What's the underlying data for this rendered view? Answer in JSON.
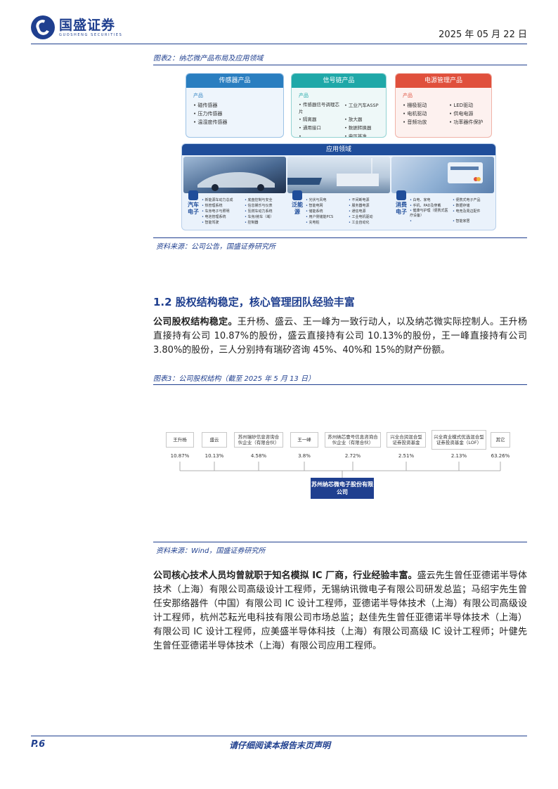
{
  "header": {
    "brand_cn": "国盛证券",
    "brand_en": "GUOSHENG SECURITIES",
    "date": "2025 年 05 月 22 日"
  },
  "figure2": {
    "caption": "图表2：纳芯微产品布局及应用领域",
    "products": [
      {
        "title": "传感器产品",
        "subtitle": "产品",
        "items": [
          "磁传感器",
          "压力传感器",
          "温湿度传感器"
        ]
      },
      {
        "title": "信号链产品",
        "subtitle": "产品",
        "items": [
          "传感器信号调理芯片",
          "工业汽车ASSP",
          "隔离器",
          "放大器",
          "通用接口",
          "数据转换器",
          "电压基准"
        ]
      },
      {
        "title": "电源管理产品",
        "subtitle": "产品",
        "items": [
          "栅极驱动",
          "LED驱动",
          "电机驱动",
          "供电电源",
          "音频功放",
          "功率器件保护"
        ]
      }
    ],
    "app_title": "应用领域",
    "apps": [
      {
        "name": "汽车电子",
        "items": [
          "新能源车动力总成",
          "底盘控制与安全",
          "热管理系统",
          "信息娱乐与仪表",
          "车身电子与照明",
          "氢燃车动力系统",
          "电池管理系统",
          "车身/舱车（域）",
          "智能驾驶",
          "控制器"
        ]
      },
      {
        "name": "泛能源",
        "items": [
          "光伏与风电",
          "不间断电源",
          "智能电网",
          "服务器电源",
          "储能系统",
          "通信电源",
          "用户侧储能PCS",
          "工业电机驱动",
          "充电桩",
          "工业自动化"
        ]
      },
      {
        "name": "消费电子",
        "items": [
          "白电、家电",
          "便携式电子产品",
          "手机、PAD及穿戴",
          "数据存储",
          "健康与护理（便携式医疗设备）",
          "电竞及周边配件",
          "",
          "智能家居"
        ]
      }
    ],
    "source": "资料来源：公司公告，国盛证券研究所"
  },
  "section": {
    "heading": "1.2  股权结构稳定，核心管理团队经验丰富",
    "para1_bold": "公司股权结构稳定。",
    "para1": "王升杨、盛云、王一峰为一致行动人，以及纳芯微实际控制人。王升杨直接持有公司 10.87%的股份，盛云直接持有公司 10.13%的股份，王一峰直接持有公司 3.80%的股份，三人分别持有瑞矽咨询 45%、40%和 15%的财产份额。"
  },
  "figure3": {
    "caption": "图表3：公司股权结构（截至 2025 年 5 月 13 日）",
    "shareholders": [
      {
        "name": "王升杨",
        "pct": "10.87%"
      },
      {
        "name": "盛云",
        "pct": "10.13%"
      },
      {
        "name": "苏州瑞矽信息咨询合伙企业（有限合伙）",
        "pct": "4.58%"
      },
      {
        "name": "王一峰",
        "pct": "3.8%"
      },
      {
        "name": "苏州纳芯壹号信息咨询合伙企业（有限合伙）",
        "pct": "2.72%"
      },
      {
        "name": "兴全合润混合型证券投资基金",
        "pct": "2.51%"
      },
      {
        "name": "兴全商业模式优选混合型证券投资基金（LOF）",
        "pct": "2.13%"
      },
      {
        "name": "其它",
        "pct": "63.26%"
      }
    ],
    "company": "苏州纳芯微电子股份有限公司",
    "source": "资料来源：Wind，国盛证券研究所"
  },
  "para2": {
    "bold": "公司核心技术人员均曾就职于知名模拟 IC 厂商，行业经验丰富。",
    "text": "盛云先生曾任亚德诺半导体技术（上海）有限公司高级设计工程师，无锡纳讯微电子有限公司研发总监；马绍宇先生曾任安那络器件（中国）有限公司 IC 设计工程师，亚德诺半导体技术（上海）有限公司高级设计工程师，杭州芯耘光电科技有限公司市场总监；赵佳先生曾任亚德诺半导体技术（上海）有限公司 IC 设计工程师，应美盛半导体科技（上海）有限公司高级 IC 设计工程师；叶健先生曾任亚德诺半导体技术（上海）有限公司应用工程师。"
  },
  "footer": {
    "page": "P.6",
    "disclaimer": "请仔细阅读本报告末页声明"
  },
  "colors": {
    "brand": "#1f3f8f",
    "sensor": "#2a7ec0",
    "signal": "#1fa8a8",
    "power": "#e0503c"
  }
}
